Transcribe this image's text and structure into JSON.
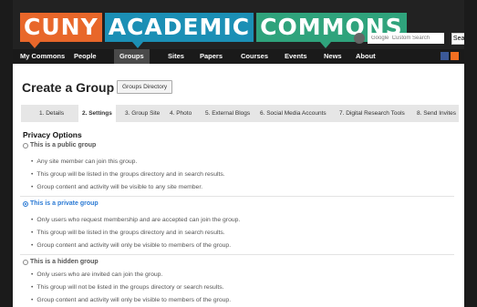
{
  "logo": {
    "words": [
      "CUNY",
      "ACADEMIC",
      "COMMONS"
    ]
  },
  "search": {
    "placeholder": "Google  Custom Search",
    "button": "Search"
  },
  "nav": {
    "items": [
      "My Commons",
      "People",
      "Groups",
      "Sites",
      "Papers",
      "Courses",
      "Events",
      "News",
      "About"
    ],
    "active": "Groups"
  },
  "page": {
    "title": "Create a Group",
    "directory_button": "Groups Directory"
  },
  "steps": [
    "1. Details",
    "2. Settings",
    "3. Group Site",
    "4. Photo",
    "5. External Blogs",
    "6. Social Media Accounts",
    "7. Digital Research Tools",
    "8. Send Invites"
  ],
  "active_step": "2. Settings",
  "privacy": {
    "title": "Privacy Options",
    "options": [
      {
        "label": "This is a public group",
        "selected": false,
        "bullets": [
          "Any site member can join this group.",
          "This group will be listed in the groups directory and in search results.",
          "Group content and activity will be visible to any site member."
        ]
      },
      {
        "label": "This is a private group",
        "selected": true,
        "bullets": [
          "Only users who request membership and are accepted can join the group.",
          "This group will be listed in the groups directory and in search results.",
          "Group content and activity will only be visible to members of the group."
        ]
      },
      {
        "label": "This is a hidden group",
        "selected": false,
        "bullets": [
          "Only users who are invited can join the group.",
          "This group will not be listed in the groups directory or search results.",
          "Group content and activity will only be visible to members of the group."
        ]
      }
    ]
  },
  "colors": {
    "logo_orange": "#e8672a",
    "logo_blue": "#1b8fb5",
    "logo_green": "#2fa37c",
    "selected_blue": "#2b7ad4"
  }
}
